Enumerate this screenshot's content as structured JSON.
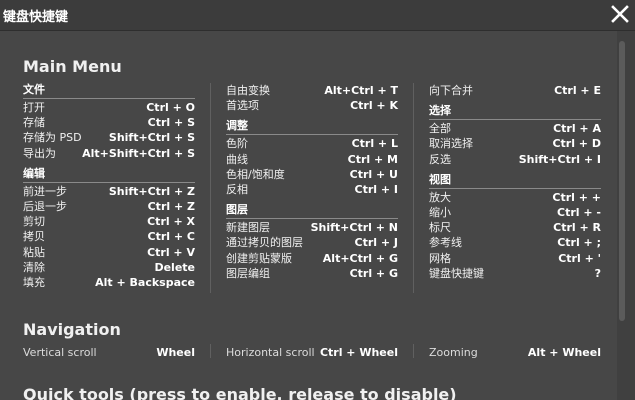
{
  "window": {
    "title": "键盘快捷键"
  },
  "sections": {
    "main_menu": "Main Menu",
    "navigation": "Navigation",
    "quick_tools": "Quick tools (press to enable, release to disable)"
  },
  "columns": [
    {
      "groups": [
        {
          "title": "文件",
          "items": [
            {
              "name": "打开",
              "key": "Ctrl + O"
            },
            {
              "name": "存储",
              "key": "Ctrl + S"
            },
            {
              "name": "存储为 PSD",
              "key": "Shift+Ctrl + S"
            },
            {
              "name": "导出为",
              "key": "Alt+Shift+Ctrl + S"
            }
          ]
        },
        {
          "title": "编辑",
          "items": [
            {
              "name": "前进一步",
              "key": "Shift+Ctrl + Z"
            },
            {
              "name": "后退一步",
              "key": "Ctrl + Z"
            },
            {
              "name": "剪切",
              "key": "Ctrl + X"
            },
            {
              "name": "拷贝",
              "key": "Ctrl + C"
            },
            {
              "name": "粘贴",
              "key": "Ctrl + V"
            },
            {
              "name": "清除",
              "key": "Delete"
            },
            {
              "name": "填充",
              "key": "Alt + Backspace"
            }
          ]
        }
      ]
    },
    {
      "groups": [
        {
          "title": "",
          "items": [
            {
              "name": "自由变换",
              "key": "Alt+Ctrl + T"
            },
            {
              "name": "首选项",
              "key": "Ctrl + K"
            }
          ]
        },
        {
          "title": "调整",
          "items": [
            {
              "name": "色阶",
              "key": "Ctrl + L"
            },
            {
              "name": "曲线",
              "key": "Ctrl + M"
            },
            {
              "name": "色相/饱和度",
              "key": "Ctrl + U"
            },
            {
              "name": "反相",
              "key": "Ctrl + I"
            }
          ]
        },
        {
          "title": "图层",
          "items": [
            {
              "name": "新建图层",
              "key": "Shift+Ctrl + N"
            },
            {
              "name": "通过拷贝的图层",
              "key": "Ctrl + J"
            },
            {
              "name": "创建剪贴蒙版",
              "key": "Alt+Ctrl + G"
            },
            {
              "name": "图层编组",
              "key": "Ctrl + G"
            }
          ]
        }
      ]
    },
    {
      "groups": [
        {
          "title": "",
          "items": [
            {
              "name": "向下合并",
              "key": "Ctrl + E"
            }
          ]
        },
        {
          "title": "选择",
          "items": [
            {
              "name": "全部",
              "key": "Ctrl + A"
            },
            {
              "name": "取消选择",
              "key": "Ctrl + D"
            },
            {
              "name": "反选",
              "key": "Shift+Ctrl + I"
            }
          ]
        },
        {
          "title": "视图",
          "items": [
            {
              "name": "放大",
              "key": "Ctrl + +"
            },
            {
              "name": "缩小",
              "key": "Ctrl + -"
            },
            {
              "name": "标尺",
              "key": "Ctrl + R"
            },
            {
              "name": "参考线",
              "key": "Ctrl + ;"
            },
            {
              "name": "网格",
              "key": "Ctrl + '"
            },
            {
              "name": "键盘快捷键",
              "key": "?"
            }
          ]
        }
      ]
    }
  ],
  "navigation": [
    {
      "name": "Vertical scroll",
      "key": "Wheel"
    },
    {
      "name": "Horizontal scroll",
      "key": "Ctrl + Wheel"
    },
    {
      "name": "Zooming",
      "key": "Alt + Wheel"
    }
  ]
}
